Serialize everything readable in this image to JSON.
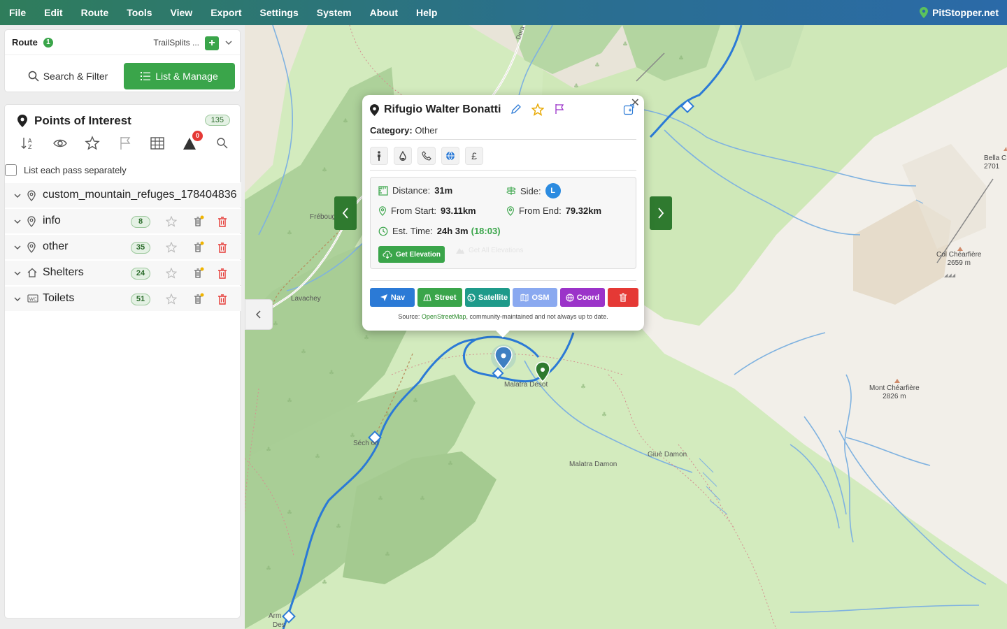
{
  "menu": [
    "File",
    "Edit",
    "Route",
    "Tools",
    "View",
    "Export",
    "Settings",
    "System",
    "About",
    "Help"
  ],
  "brand": "PitStopper.net",
  "route": {
    "label": "Route",
    "count": "1",
    "name": "TrailSplits ..."
  },
  "tabs": {
    "search": "Search & Filter",
    "list": "List & Manage"
  },
  "poi": {
    "title": "Points of Interest",
    "count": "135",
    "alert_count": "0",
    "pass_label": "List each pass separately",
    "rows": [
      {
        "label": "custom_mountain_refuges_178404836",
        "count": ""
      },
      {
        "label": "info",
        "count": "8"
      },
      {
        "label": "other",
        "count": "35"
      },
      {
        "label": "Shelters",
        "count": "24"
      },
      {
        "label": "Toilets",
        "count": "51"
      }
    ]
  },
  "map": {
    "labels": {
      "frebouge": "Fréboug",
      "lavachey": "Lavachey",
      "malatra_desot": "Malatra Desot",
      "sechon": "Séch  on",
      "malatra_damon": "Malatra Damon",
      "giue_damon": "Giuè Damon",
      "armina": "Arm",
      "des": "Des",
      "dora": "Dora",
      "bella_c": "Bella C",
      "bella_elev": "2701",
      "col_name": "Col Chéarfière",
      "col_elev": "2659 m",
      "mont_name": "Mont Chéarfière",
      "mont_elev": "2826 m"
    }
  },
  "popup": {
    "title": "Rifugio Walter Bonatti",
    "category_label": "Category:",
    "category": "Other",
    "amenity_pound": "£",
    "distance_label": "Distance:",
    "distance": "31m",
    "side_label": "Side:",
    "side": "L",
    "from_start_label": "From Start:",
    "from_start": "93.11km",
    "from_end_label": "From End:",
    "from_end": "79.32km",
    "est_label": "Est. Time:",
    "est": "24h 3m",
    "est_clock": "(18:03)",
    "get_elevation": "Get Elevation",
    "get_all_elevations": "Get All Elevations",
    "buttons": {
      "nav": "Nav",
      "street": "Street",
      "satellite": "Satellite",
      "osm": "OSM",
      "coord": "Coord"
    },
    "source_prefix": "Source: ",
    "source_link": "OpenStreetMap",
    "source_suffix": ", community-maintained and not always up to date.",
    "colors": {
      "nav": "#2b7ad6",
      "street": "#3aa54a",
      "satellite": "#1e9a8a",
      "osm": "#8aa9f0",
      "coord": "#9b33c9",
      "delete": "#e53935"
    }
  }
}
